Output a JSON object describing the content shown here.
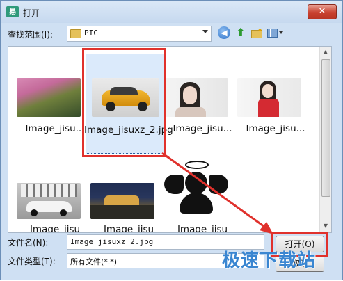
{
  "window": {
    "title": "打开",
    "close_glyph": "✕",
    "app_icon": "app-icon"
  },
  "lookin": {
    "label": "查找范围(I):",
    "value": "PIC"
  },
  "toolbar": {
    "back_glyph": "◀",
    "up_glyph": "⬆",
    "newfolder_glyph": "✶"
  },
  "files": [
    {
      "label": "Image_jisu...",
      "selected": false
    },
    {
      "label": "Image_jisuxz_2.jpg",
      "selected": true
    },
    {
      "label": "Image_jisu...",
      "selected": false
    },
    {
      "label": "Image_jisu...",
      "selected": false
    },
    {
      "label": "Image_jisu",
      "selected": false
    },
    {
      "label": "Image_jisu",
      "selected": false
    },
    {
      "label": "Image_jisu",
      "selected": false
    }
  ],
  "filename": {
    "label": "文件名(N):",
    "value": "Image_jisuxz_2.jpg"
  },
  "filetype": {
    "label": "文件类型(T):",
    "value": "所有文件(*.*)"
  },
  "buttons": {
    "open": "打开(O)",
    "cancel": "取消"
  },
  "watermark": "极速下载站",
  "colors": {
    "highlight": "#e0312c",
    "selection": "#dbeafb",
    "accent": "#3a86d1"
  }
}
